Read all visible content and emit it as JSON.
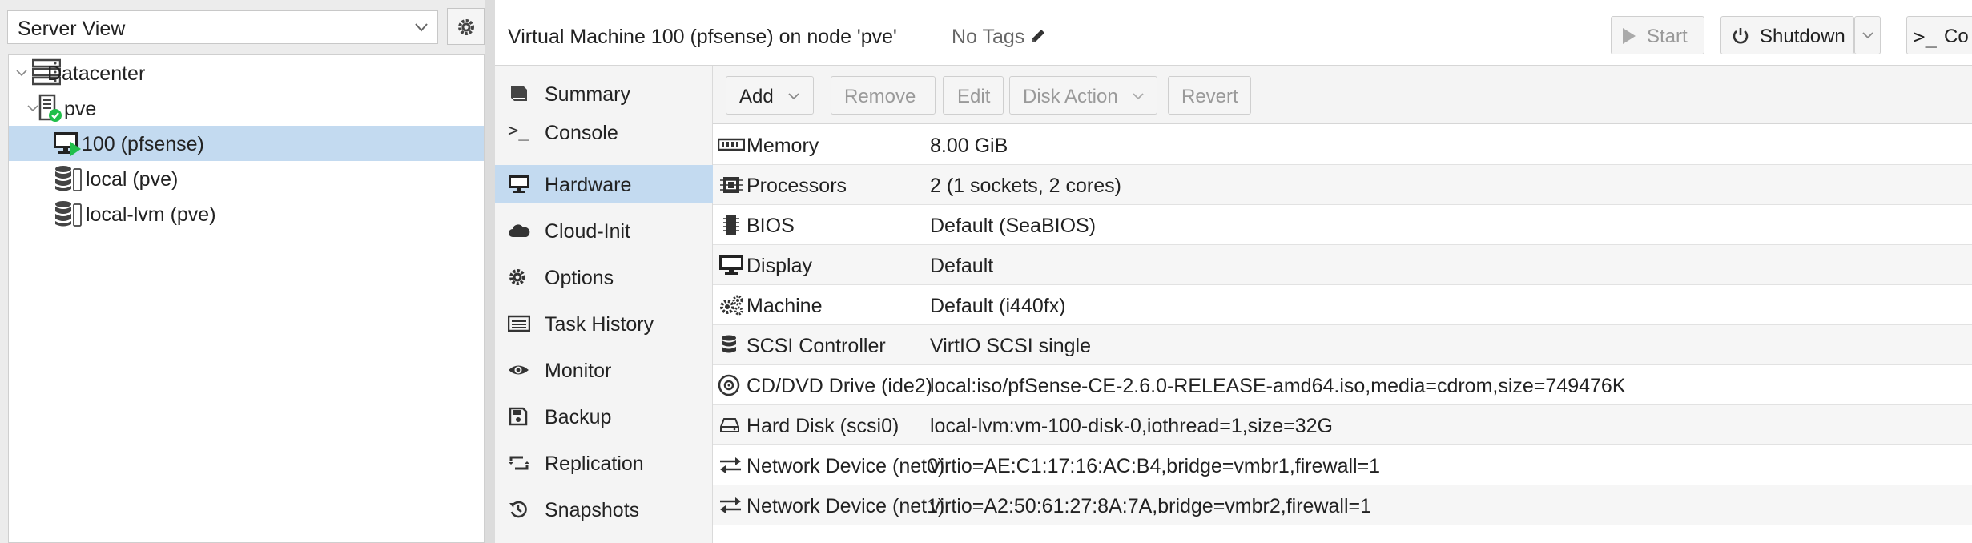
{
  "left": {
    "view_select": "Server View",
    "tree": [
      {
        "label": "Datacenter",
        "icon": "server-rack-icon",
        "level": 0,
        "expanded": true
      },
      {
        "label": "pve",
        "icon": "node-online-icon",
        "level": 1,
        "expanded": true
      },
      {
        "label": "100 (pfsense)",
        "icon": "vm-running-icon",
        "level": 2,
        "selected": true
      },
      {
        "label": "local (pve)",
        "icon": "storage-icon",
        "level": 2
      },
      {
        "label": "local-lvm (pve)",
        "icon": "storage-icon",
        "level": 2
      }
    ]
  },
  "header": {
    "title": "Virtual Machine 100 (pfsense) on node 'pve'",
    "tags": "No Tags",
    "start_label": "Start",
    "shutdown_label": "Shutdown",
    "console_label": "Co"
  },
  "subnav": [
    {
      "label": "Summary",
      "icon": "book-icon"
    },
    {
      "label": "Console",
      "icon": "terminal-icon"
    },
    {
      "label": "Hardware",
      "icon": "desktop-icon",
      "selected": true
    },
    {
      "label": "Cloud-Init",
      "icon": "cloud-icon"
    },
    {
      "label": "Options",
      "icon": "gear-icon"
    },
    {
      "label": "Task History",
      "icon": "list-icon"
    },
    {
      "label": "Monitor",
      "icon": "eye-icon"
    },
    {
      "label": "Backup",
      "icon": "floppy-icon"
    },
    {
      "label": "Replication",
      "icon": "retweet-icon"
    },
    {
      "label": "Snapshots",
      "icon": "history-icon"
    }
  ],
  "toolbar": {
    "add": "Add",
    "remove": "Remove",
    "edit": "Edit",
    "disk_action": "Disk Action",
    "revert": "Revert"
  },
  "hardware": [
    {
      "key": "Memory",
      "value": "8.00 GiB",
      "icon": "memory-icon"
    },
    {
      "key": "Processors",
      "value": "2 (1 sockets, 2 cores)",
      "icon": "cpu-icon"
    },
    {
      "key": "BIOS",
      "value": "Default (SeaBIOS)",
      "icon": "microchip-icon"
    },
    {
      "key": "Display",
      "value": "Default",
      "icon": "monitor-icon"
    },
    {
      "key": "Machine",
      "value": "Default (i440fx)",
      "icon": "cogs-icon"
    },
    {
      "key": "SCSI Controller",
      "value": "VirtIO SCSI single",
      "icon": "database-icon"
    },
    {
      "key": "CD/DVD Drive (ide2)",
      "value": "local:iso/pfSense-CE-2.6.0-RELEASE-amd64.iso,media=cdrom,size=749476K",
      "icon": "cdrom-icon"
    },
    {
      "key": "Hard Disk (scsi0)",
      "value": "local-lvm:vm-100-disk-0,iothread=1,size=32G",
      "icon": "hdd-icon"
    },
    {
      "key": "Network Device (net0)",
      "value": "virtio=AE:C1:17:16:AC:B4,bridge=vmbr1,firewall=1",
      "icon": "exchange-icon"
    },
    {
      "key": "Network Device (net1)",
      "value": "virtio=A2:50:61:27:8A:7A,bridge=vmbr2,firewall=1",
      "icon": "exchange-icon"
    }
  ]
}
